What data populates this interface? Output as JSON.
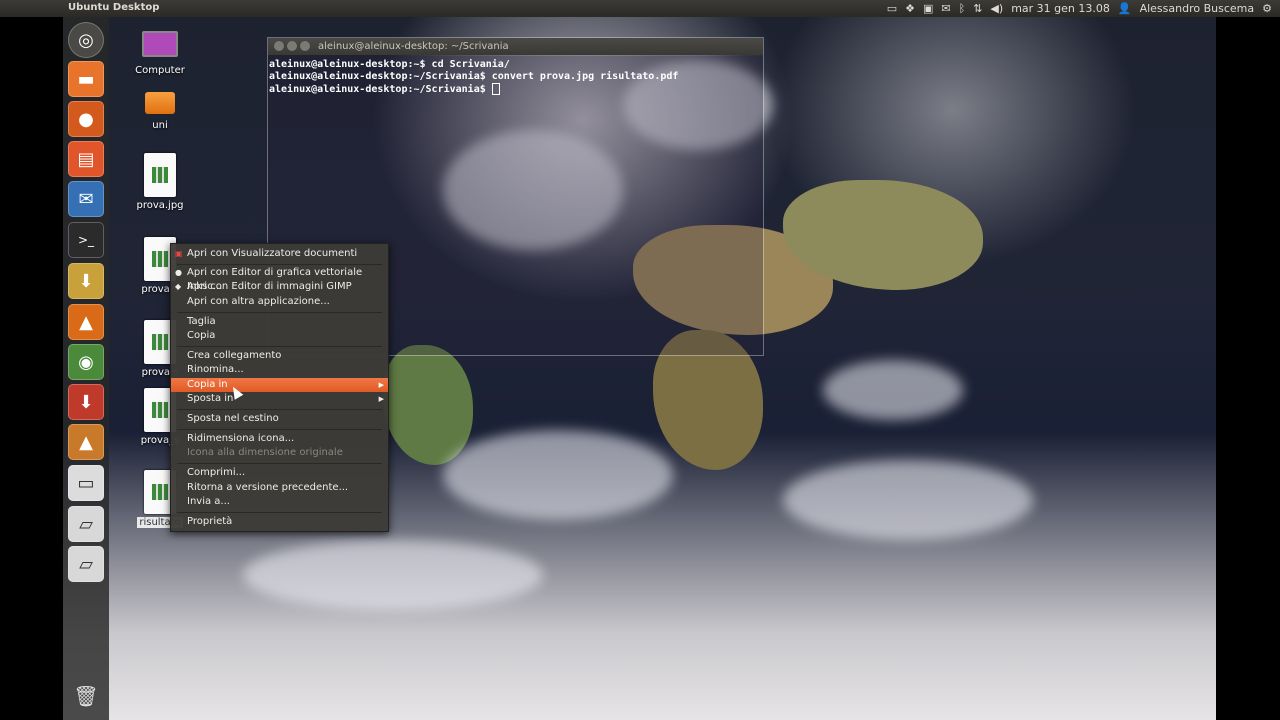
{
  "panel": {
    "title": "Ubuntu Desktop",
    "clock": "mar 31 gen 13.08",
    "user": "Alessandro Buscema"
  },
  "desktop_icons": [
    {
      "label": "Computer"
    },
    {
      "label": "uni"
    },
    {
      "label": "prova.jpg"
    },
    {
      "label": "prova-s"
    },
    {
      "label": "prova s"
    },
    {
      "label": "prova_s"
    },
    {
      "label": "risultato"
    }
  ],
  "terminal": {
    "title": "aleinux@aleinux-desktop: ~/Scrivania",
    "lines": [
      "aleinux@aleinux-desktop:~$ cd Scrivania/",
      "aleinux@aleinux-desktop:~/Scrivania$ convert prova.jpg risultato.pdf",
      "aleinux@aleinux-desktop:~/Scrivania$ "
    ]
  },
  "context_menu": {
    "items": [
      "Apri con Visualizzatore documenti",
      "Apri con Editor di grafica vettoriale Inksc...",
      "Apri con Editor di immagini GIMP",
      "Apri con altra applicazione...",
      "Taglia",
      "Copia",
      "Crea collegamento",
      "Rinomina...",
      "Copia in",
      "Sposta in",
      "Sposta nel cestino",
      "Ridimensiona icona...",
      "Icona alla dimensione originale",
      "Comprimi...",
      "Ritorna a versione precedente...",
      "Invia a...",
      "Proprietà"
    ]
  },
  "colors": {
    "highlight": "#f07746",
    "panel": "#3c3b37",
    "menu_bg": "#3c3b37"
  }
}
